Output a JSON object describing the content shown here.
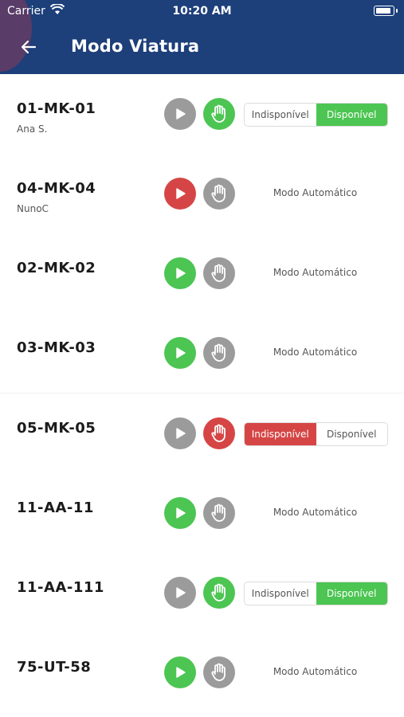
{
  "status_bar": {
    "carrier": "Carrier",
    "time": "10:20 AM"
  },
  "header": {
    "title": "Modo Viatura",
    "back_icon": "arrow-left-icon"
  },
  "colors": {
    "header": "#1d3f7a",
    "green": "#4cc552",
    "red": "#d64545",
    "grey": "#9b9b9b"
  },
  "labels": {
    "unavailable": "Indisponível",
    "available": "Disponível",
    "auto": "Modo Automático"
  },
  "vehicles": [
    {
      "plate": "01-MK-01",
      "driver": "Ana S.",
      "play": "grey",
      "hand": "green",
      "mode": "manual",
      "selected": "available"
    },
    {
      "plate": "04-MK-04",
      "driver": "NunoC",
      "play": "red",
      "hand": "grey",
      "mode": "auto"
    },
    {
      "plate": "02-MK-02",
      "driver": "",
      "play": "green",
      "hand": "grey",
      "mode": "auto"
    },
    {
      "plate": "03-MK-03",
      "driver": "",
      "play": "green",
      "hand": "grey",
      "mode": "auto"
    },
    {
      "plate": "05-MK-05",
      "driver": "",
      "play": "grey",
      "hand": "red",
      "mode": "manual",
      "selected": "unavailable"
    },
    {
      "plate": "11-AA-11",
      "driver": "",
      "play": "green",
      "hand": "grey",
      "mode": "auto"
    },
    {
      "plate": "11-AA-111",
      "driver": "",
      "play": "grey",
      "hand": "green",
      "mode": "manual",
      "selected": "available"
    },
    {
      "plate": "75-UT-58",
      "driver": "",
      "play": "green",
      "hand": "grey",
      "mode": "auto"
    }
  ]
}
